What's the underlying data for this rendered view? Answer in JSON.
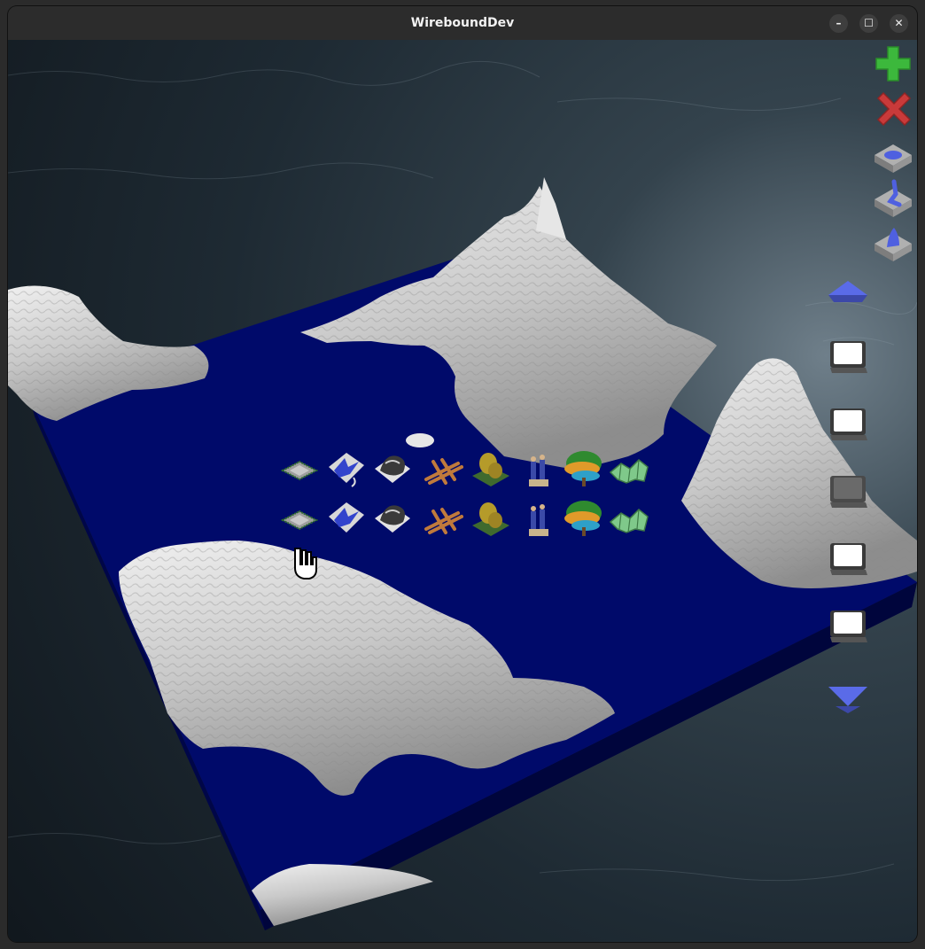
{
  "window": {
    "title": "WireboundDev",
    "minimize_glyph": "–",
    "maximize_glyph": "☐",
    "close_glyph": "✕"
  },
  "colors": {
    "titlebar": "#2c2c2c",
    "ocean": "#1a2a35",
    "water_plane": "#000a6a",
    "terrain": "#d4d4d4",
    "add_green": "#3cb83c",
    "remove_red": "#c93a3a",
    "accent_blue": "#5a6be8"
  },
  "toolbar": {
    "items": [
      {
        "name": "add-button",
        "icon": "plus-icon"
      },
      {
        "name": "remove-button",
        "icon": "x-icon"
      },
      {
        "name": "water-pool-tool",
        "icon": "pool-tile-icon"
      },
      {
        "name": "river-tool",
        "icon": "river-tile-icon"
      },
      {
        "name": "water-source-tool",
        "icon": "source-tile-icon"
      },
      {
        "name": "raise-level-button",
        "icon": "triangle-up-icon"
      },
      {
        "name": "layer-slot-1",
        "icon": "slot-icon"
      },
      {
        "name": "layer-slot-2",
        "icon": "slot-icon"
      },
      {
        "name": "layer-slot-3",
        "icon": "slot-icon",
        "disabled": true
      },
      {
        "name": "layer-slot-4",
        "icon": "slot-icon"
      },
      {
        "name": "layer-slot-5",
        "icon": "slot-icon"
      },
      {
        "name": "lower-level-button",
        "icon": "triangle-down-icon"
      }
    ]
  },
  "palette": {
    "rows": [
      [
        "chip-tile-icon",
        "blue-bird-tile-icon",
        "rock-tile-icon",
        "fence-tile-icon",
        "lion-statue-tile-icon",
        "figures-tile-icon",
        "tree-tile-icon",
        "map-tile-icon"
      ],
      [
        "chip-tile-icon",
        "blue-bird-tile-icon",
        "rock-tile-icon",
        "fence-tile-icon",
        "lion-statue-tile-icon",
        "figures-tile-icon",
        "tree-tile-icon",
        "map-tile-icon"
      ]
    ]
  },
  "cursor": {
    "icon": "hand-cursor-icon"
  }
}
